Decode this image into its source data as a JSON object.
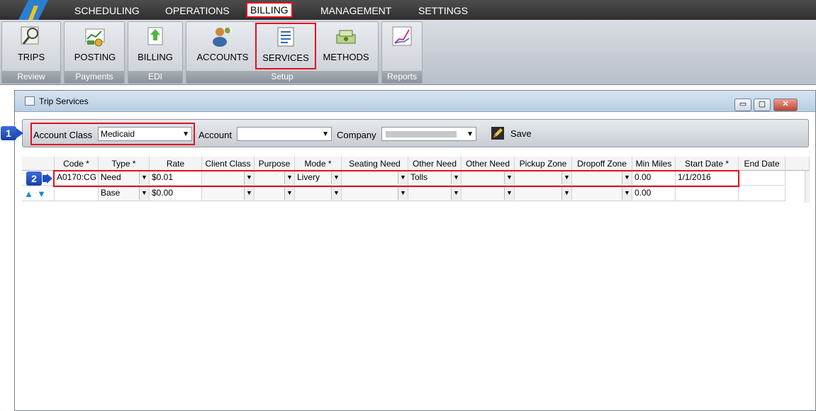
{
  "menu": {
    "items": [
      "SCHEDULING",
      "OPERATIONS",
      "BILLING",
      "MANAGEMENT",
      "SETTINGS"
    ],
    "active": "BILLING"
  },
  "ribbon": {
    "groups": {
      "review": "Review",
      "payments": "Payments",
      "edi": "EDI",
      "setup": "Setup",
      "reports": "Reports"
    },
    "buttons": {
      "trips": "TRIPS",
      "posting": "POSTING",
      "billing": "BILLING",
      "accounts": "ACCOUNTS",
      "services": "SERVICES",
      "methods": "METHODS"
    }
  },
  "window": {
    "title": "Trip Services"
  },
  "filter": {
    "account_class_label": "Account Class",
    "account_class_value": "Medicaid",
    "account_label": "Account",
    "account_value": "",
    "company_label": "Company",
    "save_label": "Save"
  },
  "badges": {
    "one": "1",
    "two": "2"
  },
  "grid": {
    "headers": {
      "code": "Code *",
      "type": "Type *",
      "rate": "Rate",
      "client_class": "Client Class",
      "purpose": "Purpose",
      "mode": "Mode *",
      "seating_need": "Seating Need",
      "other_need_1": "Other Need",
      "other_need_2": "Other Need",
      "pickup_zone": "Pickup Zone",
      "dropoff_zone": "Dropoff Zone",
      "min_miles": "Min Miles",
      "start_date": "Start Date *",
      "end_date": "End Date"
    },
    "rows": [
      {
        "code": "A0170:CG",
        "type": "Need",
        "rate": "$0.01",
        "client_class": "",
        "purpose": "",
        "mode": "Livery",
        "seating_need": "",
        "other_need_1": "Tolls",
        "other_need_2": "",
        "pickup_zone": "",
        "dropoff_zone": "",
        "min_miles": "0.00",
        "start_date": "1/1/2016",
        "end_date": ""
      },
      {
        "code": "",
        "type": "Base",
        "rate": "$0.00",
        "client_class": "",
        "purpose": "",
        "mode": "",
        "seating_need": "",
        "other_need_1": "",
        "other_need_2": "",
        "pickup_zone": "",
        "dropoff_zone": "",
        "min_miles": "0.00",
        "start_date": "",
        "end_date": ""
      }
    ]
  },
  "colors": {
    "highlight_red": "#e01020",
    "badge_blue": "#1f4fc8",
    "arrow_blue": "#1f86d6"
  }
}
